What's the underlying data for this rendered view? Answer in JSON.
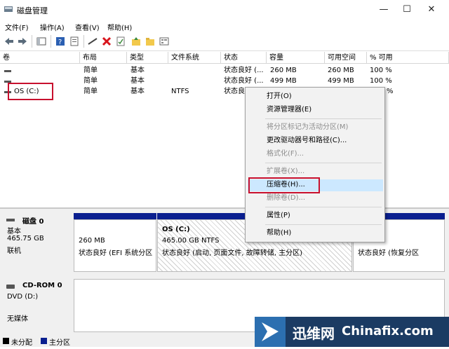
{
  "window": {
    "title": "磁盘管理",
    "minimize": "—",
    "maximize": "☐",
    "close": "✕"
  },
  "menu": [
    "文件(F)",
    "操作(A)",
    "查看(V)",
    "帮助(H)"
  ],
  "columns": [
    "卷",
    "布局",
    "类型",
    "文件系统",
    "状态",
    "容量",
    "可用空间",
    "% 可用"
  ],
  "volumes": [
    {
      "name": "",
      "layout": "简单",
      "type": "基本",
      "fs": "",
      "status": "状态良好 (...",
      "capacity": "260 MB",
      "free": "260 MB",
      "pct": "100 %"
    },
    {
      "name": "",
      "layout": "简单",
      "type": "基本",
      "fs": "",
      "status": "状态良好 (...",
      "capacity": "499 MB",
      "free": "499 MB",
      "pct": "100 %"
    },
    {
      "name": "OS (C:)",
      "layout": "简单",
      "type": "基本",
      "fs": "NTFS",
      "status": "状态良",
      "capacity": "",
      "free": "",
      "pct": "%"
    }
  ],
  "context_menu": {
    "items": [
      {
        "label": "打开(O)",
        "enabled": true
      },
      {
        "label": "资源管理器(E)",
        "enabled": true
      },
      {
        "label": "将分区标记为活动分区(M)",
        "enabled": false
      },
      {
        "label": "更改驱动器号和路径(C)...",
        "enabled": true
      },
      {
        "label": "格式化(F)...",
        "enabled": false
      },
      {
        "label": "扩展卷(X)...",
        "enabled": false
      },
      {
        "label": "压缩卷(H)...",
        "enabled": true
      },
      {
        "label": "删除卷(D)...",
        "enabled": false
      },
      {
        "label": "属性(P)",
        "enabled": true
      },
      {
        "label": "帮助(H)",
        "enabled": true
      }
    ]
  },
  "disk0": {
    "name": "磁盘 0",
    "type": "基本",
    "size": "465.75 GB",
    "state": "联机",
    "partitions": [
      {
        "title": "",
        "size": "260 MB",
        "status": "状态良好 (EFI 系统分区"
      },
      {
        "title": "OS  (C:)",
        "size": "465.00 GB NTFS",
        "status": "状态良好 (启动, 页面文件, 故障转储, 主分区)"
      },
      {
        "title": "",
        "size": "",
        "status": "状态良好 (恢复分区"
      }
    ]
  },
  "cdrom0": {
    "name": "CD-ROM 0",
    "type": "DVD (D:)",
    "media": "无媒体"
  },
  "legend": {
    "unallocated": "未分配",
    "primary": "主分区"
  },
  "watermark": {
    "brand_cn": "迅维网",
    "brand_en": "Chinafix.com"
  },
  "colors": {
    "partition_header": "#0a1f8f",
    "highlight": "#cce8ff",
    "red_box": "#c8102e"
  }
}
